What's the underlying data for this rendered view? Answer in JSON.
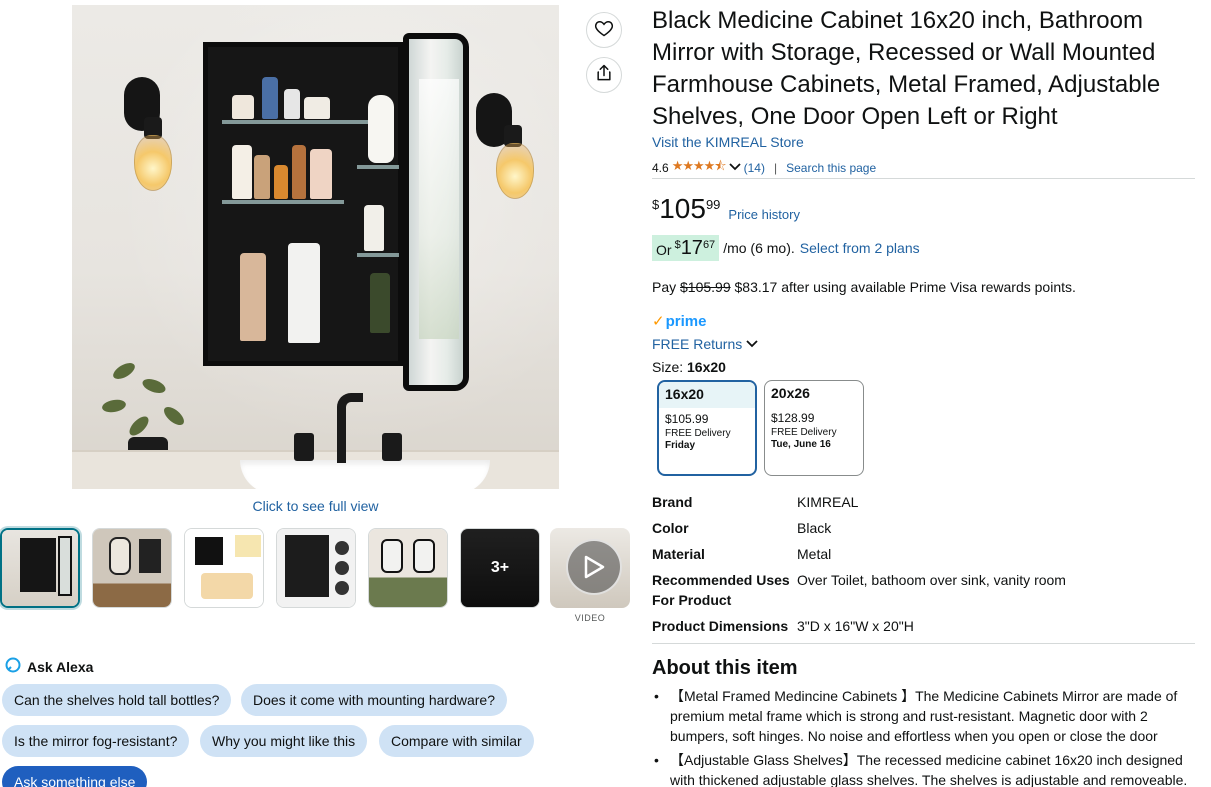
{
  "product": {
    "title": "Black Medicine Cabinet 16x20 inch, Bathroom Mirror with Storage, Recessed or Wall Mounted Farmhouse Cabinets, Metal Framed, Adjustable Shelves, One Door Open Left or Right",
    "store_link": "Visit the KIMREAL Store",
    "rating_value": "4.6",
    "rating_stars": "★★★★⯪",
    "rating_count": "(14)",
    "search_page": "Search this page"
  },
  "gallery": {
    "full_view_label": "Click to see full view",
    "more_count": "3+",
    "video_label": "VIDEO",
    "wishlist_icon": "heart-icon",
    "share_icon": "share-icon"
  },
  "price": {
    "currency": "$",
    "whole": "105",
    "fraction": "99",
    "price_history": "Price history",
    "monthly_prefix": "Or",
    "monthly_currency": "$",
    "monthly_whole": "17",
    "monthly_fraction": "67",
    "monthly_suffix": "/mo (6 mo).",
    "plans_link": "Select from 2 plans",
    "pay_prefix": "Pay",
    "pay_strike": "$105.99",
    "pay_rest": "$83.17 after using available Prime Visa rewards points."
  },
  "delivery": {
    "prime_label": "prime",
    "free_returns": "FREE Returns"
  },
  "size": {
    "label": "Size:",
    "selected": "16x20",
    "options": [
      {
        "name": "16x20",
        "price": "$105.99",
        "delivery_prefix": "FREE Delivery",
        "delivery_day": "Friday"
      },
      {
        "name": "20x26",
        "price": "$128.99",
        "delivery_prefix": "FREE Delivery",
        "delivery_day": "Tue, June 16"
      }
    ]
  },
  "specs": [
    {
      "key": "Brand",
      "value": "KIMREAL"
    },
    {
      "key": "Color",
      "value": "Black"
    },
    {
      "key": "Material",
      "value": "Metal"
    },
    {
      "key": "Recommended Uses For Product",
      "value": "Over Toilet, bathoom over sink, vanity room"
    },
    {
      "key": "Product Dimensions",
      "value": "3\"D x 16\"W x 20\"H"
    }
  ],
  "about": {
    "heading": "About this item",
    "bullets": [
      "【Metal Framed Medincine Cabinets 】The Medicine Cabinets Mirror are made of premium metal frame which is strong and rust-resistant. Magnetic door with 2 bumpers, soft hinges. No noise and effortless when you open or close the door",
      "【Adjustable Glass Shelves】The recessed medicine cabinet 16x20 inch designed with thickened adjustable glass shelves. The shelves is adjustable and removeable."
    ]
  },
  "alexa": {
    "heading": "Ask Alexa",
    "chips": [
      "Can the shelves hold tall bottles?",
      "Does it come with mounting hardware?",
      "Is the mirror fog-resistant?",
      "Why you might like this",
      "Compare with similar",
      "Ask something else"
    ]
  },
  "colors": {
    "link": "#2162a1",
    "star": "#de7921",
    "prime_blue": "#1a98ff",
    "monthly_highlight": "#cdf0de",
    "chip_bg": "#cfe2f5",
    "chip_dark": "#1f5fbf",
    "selected_border": "#007185"
  }
}
